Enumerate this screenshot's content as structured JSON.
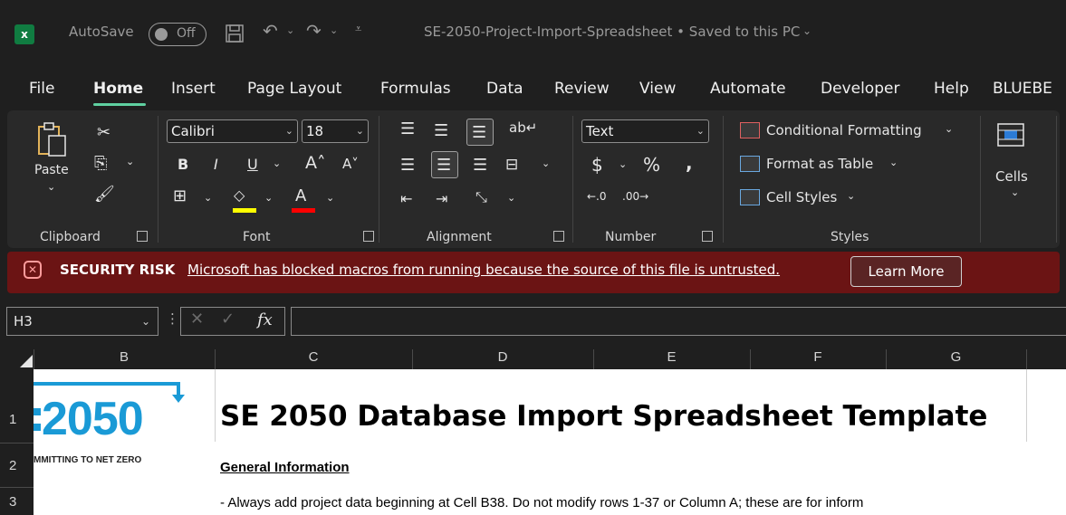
{
  "titlebar": {
    "app_icon": "excel-icon",
    "autosave_label": "AutoSave",
    "autosave_state": "Off",
    "doc_title": "SE-2050-Project-Import-Spreadsheet • Saved to this PC"
  },
  "menu": {
    "tabs": [
      "File",
      "Home",
      "Insert",
      "Page Layout",
      "Formulas",
      "Data",
      "Review",
      "View",
      "Automate",
      "Developer",
      "Help",
      "BLUEBE"
    ],
    "active": "Home"
  },
  "ribbon": {
    "clipboard": {
      "paste_label": "Paste",
      "group_label": "Clipboard"
    },
    "font": {
      "font_name": "Calibri",
      "font_size": "18",
      "group_label": "Font"
    },
    "alignment": {
      "group_label": "Alignment"
    },
    "number": {
      "format": "Text",
      "group_label": "Number"
    },
    "styles": {
      "conditional_formatting": "Conditional Formatting",
      "format_as_table": "Format as Table",
      "cell_styles": "Cell Styles",
      "group_label": "Styles"
    },
    "cells": {
      "label": "Cells"
    }
  },
  "security": {
    "title": "SECURITY RISK",
    "message": "Microsoft has blocked macros from running because the source of this file is untrusted.",
    "button": "Learn More",
    "color": "#6b1414"
  },
  "formula_bar": {
    "name_box": "H3",
    "fx_label": "fx",
    "value": ""
  },
  "grid": {
    "columns": [
      "B",
      "C",
      "D",
      "E",
      "F",
      "G"
    ],
    "rows": [
      "1",
      "2",
      "3"
    ],
    "logo": {
      "number": "2050",
      "tagline": "MMITTING TO NET ZERO",
      "color": "#1a9ad6"
    },
    "title": "SE 2050 Database Import Spreadsheet Template",
    "section_heading": "General Information",
    "row3_text": "- Always add project data beginning at Cell B38. Do not modify rows 1-37 or Column A; these are for inform"
  }
}
